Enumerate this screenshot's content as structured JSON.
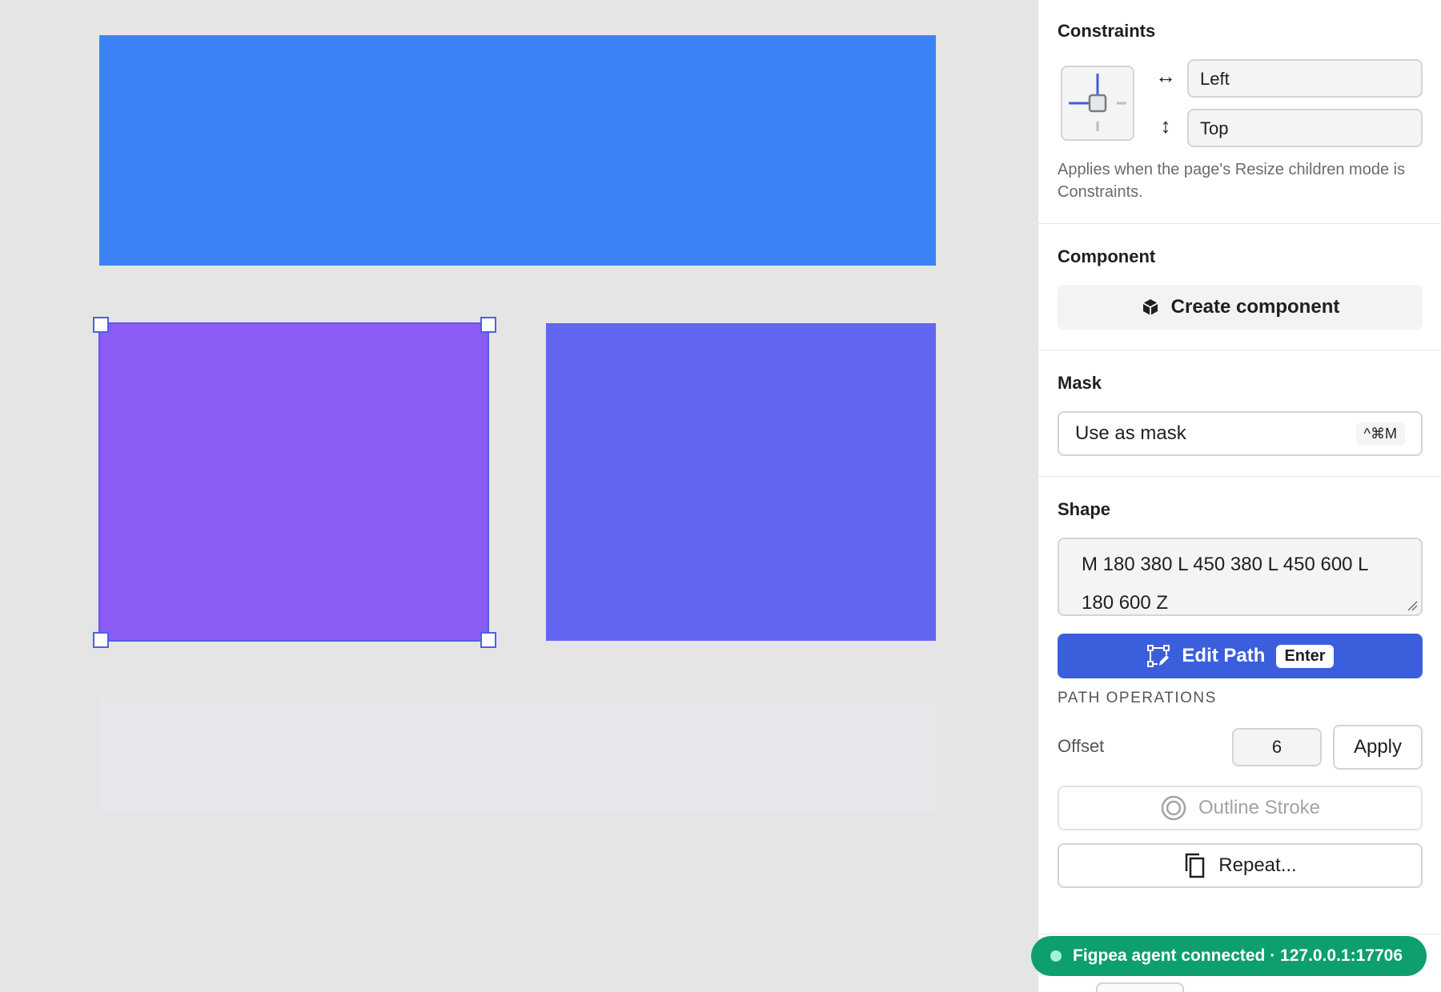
{
  "canvas": {
    "shapes": [
      {
        "name": "blue-rectangle",
        "color": "#3b82f6"
      },
      {
        "name": "purple-rectangle",
        "color": "#8b5cf6",
        "selected": true
      },
      {
        "name": "indigo-rectangle",
        "color": "#6366f1"
      },
      {
        "name": "light-rectangle",
        "color": "#e6e7ea"
      }
    ]
  },
  "constraints": {
    "title": "Constraints",
    "horizontal_icon": "horizontal-arrows-icon",
    "vertical_icon": "vertical-arrows-icon",
    "horizontal_value": "Left",
    "vertical_value": "Top",
    "hint": "Applies when the page's Resize children mode is Constraints."
  },
  "component": {
    "title": "Component",
    "create_label": "Create component",
    "icon": "component-cube-icon"
  },
  "mask": {
    "title": "Mask",
    "use_label": "Use as mask",
    "shortcut": "^⌘M"
  },
  "shape": {
    "title": "Shape",
    "path_value": "M 180 380 L 450 380 L 450 600 L 180 600 Z",
    "edit_label": "Edit Path",
    "edit_shortcut": "Enter",
    "ops_label": "PATH OPERATIONS",
    "offset_label": "Offset",
    "offset_value": "6",
    "apply_label": "Apply",
    "outline_label": "Outline Stroke",
    "repeat_label": "Repeat..."
  },
  "toast": {
    "text": "Figpea agent connected · 127.0.0.1:17706",
    "color": "#0e9f6e"
  }
}
